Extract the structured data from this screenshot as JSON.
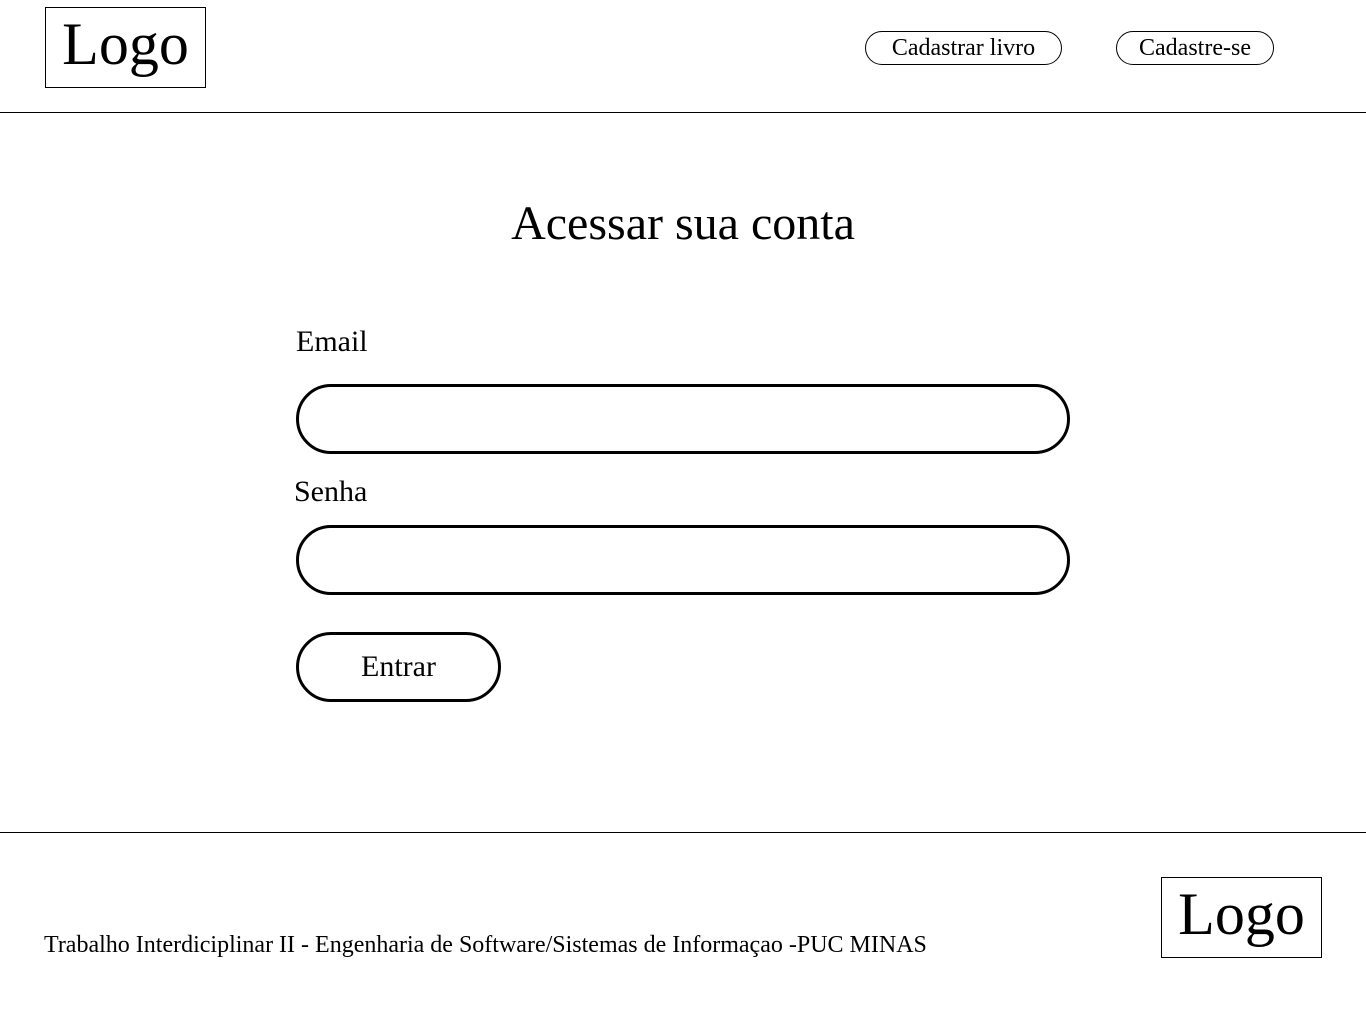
{
  "header": {
    "logo_text": "Logo",
    "nav": {
      "register_book_label": "Cadastrar livro",
      "sign_up_label": "Cadastre-se"
    }
  },
  "main": {
    "title": "Acessar sua conta",
    "form": {
      "email_label": "Email",
      "email_value": "",
      "password_label": "Senha",
      "password_value": "",
      "submit_label": "Entrar"
    }
  },
  "footer": {
    "text": "Trabalho Interdiciplinar II - Engenharia de Software/Sistemas de Informaçao -PUC MINAS",
    "logo_text": "Logo"
  }
}
